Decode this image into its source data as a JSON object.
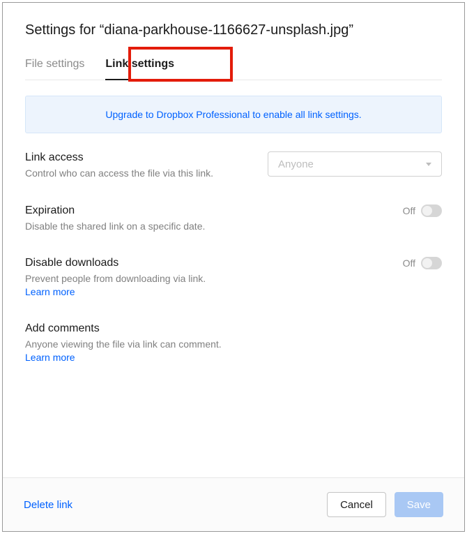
{
  "title": "Settings for “diana-parkhouse-1166627-unsplash.jpg”",
  "tabs": {
    "file": "File settings",
    "link": "Link settings"
  },
  "banner": "Upgrade to Dropbox Professional to enable all link settings.",
  "linkAccess": {
    "label": "Link access",
    "desc": "Control who can access the file via this link.",
    "selected": "Anyone"
  },
  "expiration": {
    "label": "Expiration",
    "desc": "Disable the shared link on a specific date.",
    "toggle": "Off"
  },
  "downloads": {
    "label": "Disable downloads",
    "desc": "Prevent people from downloading via link.",
    "learn": "Learn more",
    "toggle": "Off"
  },
  "comments": {
    "label": "Add comments",
    "desc": "Anyone viewing the file via link can comment. ",
    "learn": "Learn more"
  },
  "footer": {
    "delete": "Delete link",
    "cancel": "Cancel",
    "save": "Save"
  }
}
